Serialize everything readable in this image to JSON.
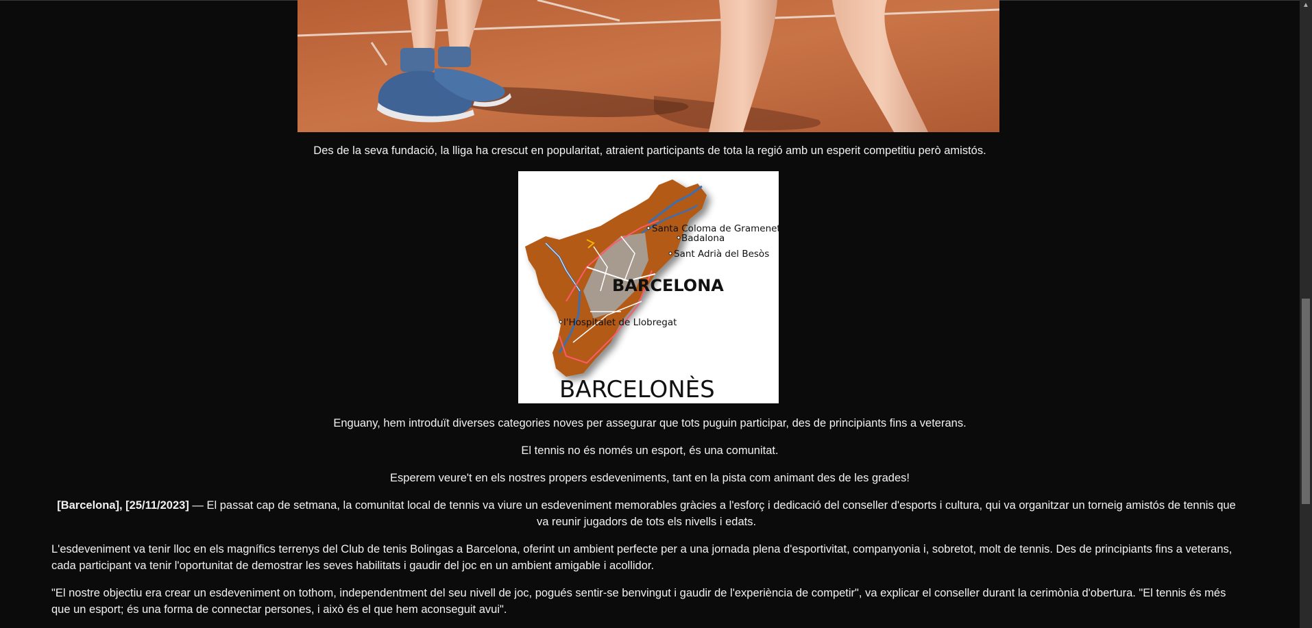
{
  "page": {
    "caption_1": "Des de la seva fundació, la lliga ha crescut en popularitat, atraient participants de tota la regió amb un esperit competitiu però amistós.",
    "caption_2": "Enguany, hem introduït diverses categories noves per assegurar que tots puguin participar, des de principiants fins a veterans.",
    "caption_3": "El tennis no és només un esport, és una comunitat.",
    "caption_4": "Esperem veure't en els nostres propers esdeveniments, tant en la pista com animant des de les grades!"
  },
  "map": {
    "title": "BARCELONÈS",
    "city": "BARCELONA",
    "places": [
      "Santa Coloma de Gramenet",
      "Badalona",
      "Sant Adrià del Besòs",
      "l'Hospitalet de Llobregat"
    ]
  },
  "article": {
    "dateline": "[Barcelona], [25/11/2023]",
    "lead_rest": " — El passat cap de setmana, la comunitat local de tennis va viure un esdeveniment memorables gràcies a l'esforç i dedicació del conseller d'esports i cultura, qui va organitzar un torneig amistós de tennis que va reunir jugadors de tots els nivells i edats.",
    "paragraph_2": "L'esdeveniment va tenir lloc en els magnífics terrenys del Club de tenis Bolingas a Barcelona, oferint un ambient perfecte per a una jornada plena d'esportivitat, companyonia i, sobretot, molt de tennis. Des de principiants fins a veterans, cada participant va tenir l'oportunitat de demostrar les seves habilitats i gaudir del joc en un ambient amigable i acollidor.",
    "paragraph_3": "\"El nostre objectiu era crear un esdeveniment on tothom, independentment del seu nivell de joc, pogués sentir-se benvingut i gaudir de l'experiència de competir\", va explicar el conseller durant la cerimònia d'obertura. \"El tennis és més que un esport; és una forma de connectar persones, i això és el que hem aconseguit avui\"."
  },
  "colors": {
    "background": "#0b0b0c",
    "text": "#f2f2f2",
    "clay": "#c4683a",
    "map_fill": "#b25a12"
  },
  "icons": {
    "scroll_up": "chevron-up-icon"
  }
}
